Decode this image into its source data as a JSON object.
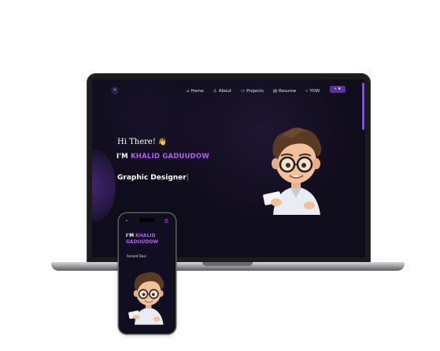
{
  "laptop": {
    "nav": {
      "logo_icon": "logo-icon",
      "items": [
        {
          "label": "Home",
          "icon": "⌂"
        },
        {
          "label": "About",
          "icon": "♙"
        },
        {
          "label": "Projects",
          "icon": "▭"
        },
        {
          "label": "Resume",
          "icon": "▤"
        },
        {
          "label": "YOW",
          "icon": "⑂"
        }
      ],
      "toggle": "⑂ ★"
    },
    "hero": {
      "greeting": "Hi There!",
      "wave": "👋",
      "im_prefix": "I'M ",
      "name": "KHALID GADUUDOW",
      "role": "Graphic Designer",
      "caret": "|"
    }
  },
  "phone": {
    "menu_icon": "☰",
    "im_prefix": "I'M ",
    "name": "KHALID GADUUDOW",
    "role": "Farand Desi"
  },
  "colors": {
    "accent": "#b55cf2",
    "background": "#0f0c1b",
    "toggle": "#5a2ea6"
  }
}
